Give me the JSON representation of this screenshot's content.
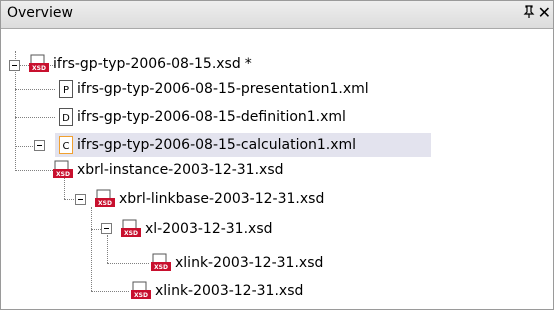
{
  "panel": {
    "title": "Overview",
    "pin_glyph": "ᵽ",
    "close_glyph": "✕"
  },
  "tree": {
    "root": {
      "label": "ifrs-gp-typ-2006-08-15.xsd",
      "modified_marker": "*",
      "icon": "xsd-file-icon"
    },
    "linkbases": [
      {
        "label": "ifrs-gp-typ-2006-08-15-presentation1.xml",
        "badge": "P",
        "icon": "presentation-linkbase-icon"
      },
      {
        "label": "ifrs-gp-typ-2006-08-15-definition1.xml",
        "badge": "D",
        "icon": "definition-linkbase-icon"
      },
      {
        "label": "ifrs-gp-typ-2006-08-15-calculation1.xml",
        "badge": "C",
        "icon": "calculation-linkbase-icon",
        "selected": true
      }
    ],
    "nodes": [
      {
        "label": "xbrl-instance-2003-12-31.xsd",
        "icon": "xsd-file-icon"
      },
      {
        "label": "xbrl-linkbase-2003-12-31.xsd",
        "icon": "xsd-file-icon"
      },
      {
        "label": "xl-2003-12-31.xsd",
        "icon": "xsd-file-icon"
      },
      {
        "label": "xlink-2003-12-31.xsd",
        "icon": "xsd-file-icon"
      },
      {
        "label": "xlink-2003-12-31.xsd",
        "icon": "xsd-file-icon"
      }
    ]
  },
  "colors": {
    "selection": "#e3e3ee",
    "xsd_icon_red": "#c8102e",
    "badge_orange": "#f0a030"
  }
}
